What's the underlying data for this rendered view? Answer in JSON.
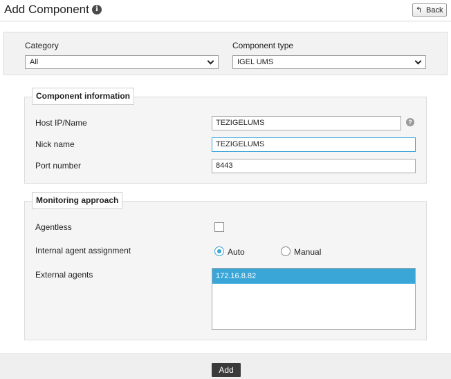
{
  "header": {
    "title": "Add Component",
    "info_icon": "i",
    "back_label": "Back",
    "back_icon": "↰"
  },
  "filters": {
    "category_label": "Category",
    "category_value": "All",
    "component_type_label": "Component type",
    "component_type_value": "IGEL UMS"
  },
  "component_info": {
    "legend": "Component information",
    "host_label": "Host IP/Name",
    "host_value": "TEZIGELUMS",
    "help_icon": "?",
    "nick_label": "Nick name",
    "nick_value": "TEZIGELUMS",
    "port_label": "Port number",
    "port_value": "8443"
  },
  "monitoring": {
    "legend": "Monitoring approach",
    "agentless_label": "Agentless",
    "agentless_checked": false,
    "assignment_label": "Internal agent assignment",
    "auto_label": "Auto",
    "manual_label": "Manual",
    "assignment_selected": "Auto",
    "external_label": "External agents",
    "external_agents": [
      "172.16.8.82"
    ]
  },
  "footer": {
    "add_label": "Add"
  },
  "colors": {
    "accent": "#3aa6d8",
    "button_dark": "#3a3a3a"
  }
}
